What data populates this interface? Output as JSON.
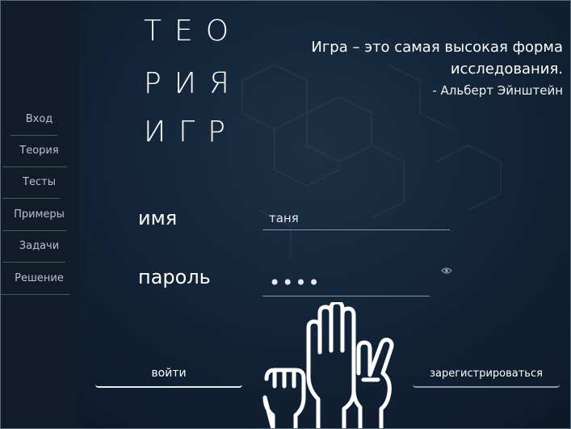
{
  "sidebar": {
    "items": [
      {
        "label": "Вход"
      },
      {
        "label": "Теория"
      },
      {
        "label": "Тесты"
      },
      {
        "label": "Примеры"
      },
      {
        "label": "Задачи"
      },
      {
        "label": "Решение"
      }
    ]
  },
  "logo": {
    "line1": "ТЕО",
    "line2": "РИЯ",
    "line3": "ИГР"
  },
  "quote": {
    "line1": "Игра – это самая высокая форма",
    "line2": "исследования.",
    "author": "- Альберт Эйнштейн"
  },
  "form": {
    "name_label": "имя",
    "name_value": "таня",
    "password_label": "пароль",
    "password_value": "••••"
  },
  "buttons": {
    "login": "войти",
    "register": "зарегистрироваться"
  },
  "icons": {
    "eye": "eye-icon",
    "hands": "raised-hands-illustration"
  },
  "colors": {
    "background": "#132438",
    "sidebar": "#111c27",
    "text": "#ffffff",
    "underline": "#7f94ad"
  }
}
